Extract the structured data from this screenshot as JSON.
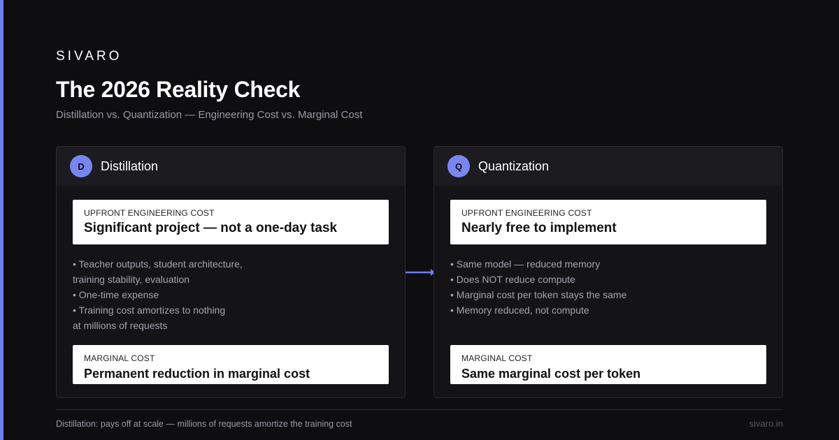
{
  "brand": "SIVARO",
  "title": "The 2026 Reality Check",
  "subtitle": "Distillation vs. Quantization — Engineering Cost vs. Marginal Cost",
  "colors": {
    "background": "#0e0e10",
    "accent": "#6f7ef2",
    "badge": "#7a86f0",
    "card": "#ffffff"
  },
  "panels": [
    {
      "badge": "D",
      "title": "Distillation",
      "upfront_label": "UPFRONT ENGINEERING COST",
      "upfront_value": "Significant project — not a one-day task",
      "bullets": [
        "• Teacher outputs, student architecture,",
        "training stability, evaluation",
        "• One-time expense",
        "• Training cost amortizes to nothing",
        "at millions of requests"
      ],
      "marginal_label": "MARGINAL COST",
      "marginal_value": "Permanent reduction in marginal cost"
    },
    {
      "badge": "Q",
      "title": "Quantization",
      "upfront_label": "UPFRONT ENGINEERING COST",
      "upfront_value": "Nearly free to implement",
      "bullets": [
        "• Same model — reduced memory",
        "• Does NOT reduce compute",
        "• Marginal cost per token stays the same",
        "• Memory reduced, not compute"
      ],
      "marginal_label": "MARGINAL COST",
      "marginal_value": "Same marginal cost per token"
    }
  ],
  "connector_icon": "arrow-right-icon",
  "footer": {
    "note": "Distillation: pays off at scale — millions of requests amortize the training cost",
    "url": "sivaro.in"
  }
}
